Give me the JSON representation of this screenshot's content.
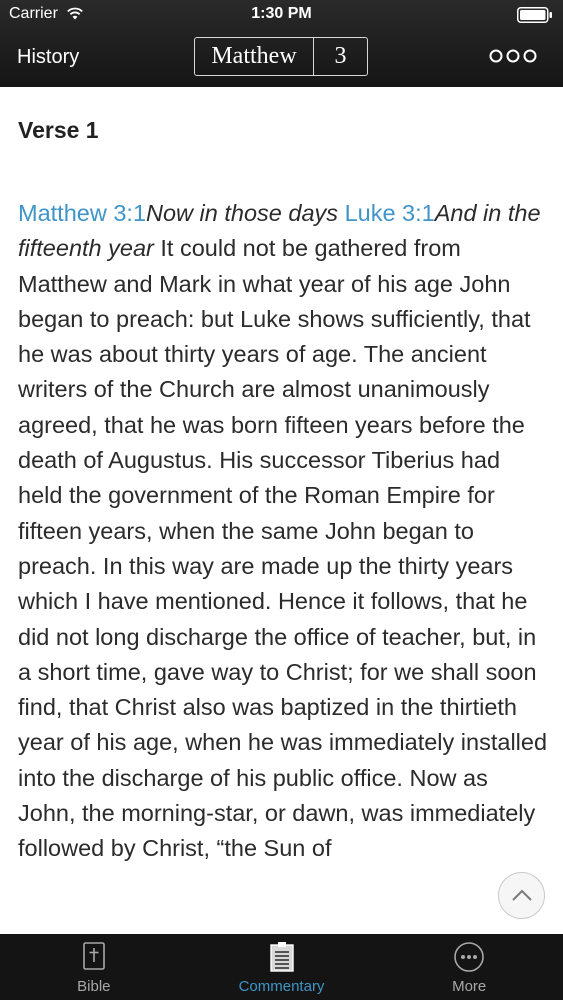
{
  "status_bar": {
    "carrier": "Carrier",
    "time": "1:30 PM"
  },
  "nav": {
    "history_label": "History",
    "book": "Matthew",
    "chapter": "3",
    "more_icon": "ellipsis-icon"
  },
  "content": {
    "verse_heading": "Verse 1",
    "segments": {
      "ref1": "Matthew 3:1",
      "quote1": "Now in those days ",
      "ref2": "Luke 3:1",
      "quote2": "And in the fifteenth year",
      "body": " It could not be gathered from Matthew and Mark in what year of his age John began to preach: but Luke shows sufficiently, that he was about thirty years of age. The ancient writers of the Church are almost unanimously agreed, that he was born fifteen years before the death of Augustus. His successor Tiberius had held the government of the Roman Empire for fifteen years, when the same John began to preach. In this way are made up the thirty years which I have mentioned. Hence it follows, that he did not long discharge the office of teacher, but, in a short time, gave way to Christ; for we shall soon find, that Christ also was baptized in the thirtieth year of his age, when he was immediately installed into the discharge of his public office. Now as John, the morning-star, or dawn, was immediately followed by Christ, “the Sun of"
    }
  },
  "tabs": [
    {
      "label": "Bible",
      "icon": "cross-book-icon",
      "active": false
    },
    {
      "label": "Commentary",
      "icon": "document-icon",
      "active": true
    },
    {
      "label": "More",
      "icon": "more-circle-icon",
      "active": false
    }
  ],
  "colors": {
    "accent": "#3f94c8",
    "topbar": "#1c1c1c",
    "tabbar": "#141414",
    "text": "#2b2b2b"
  }
}
